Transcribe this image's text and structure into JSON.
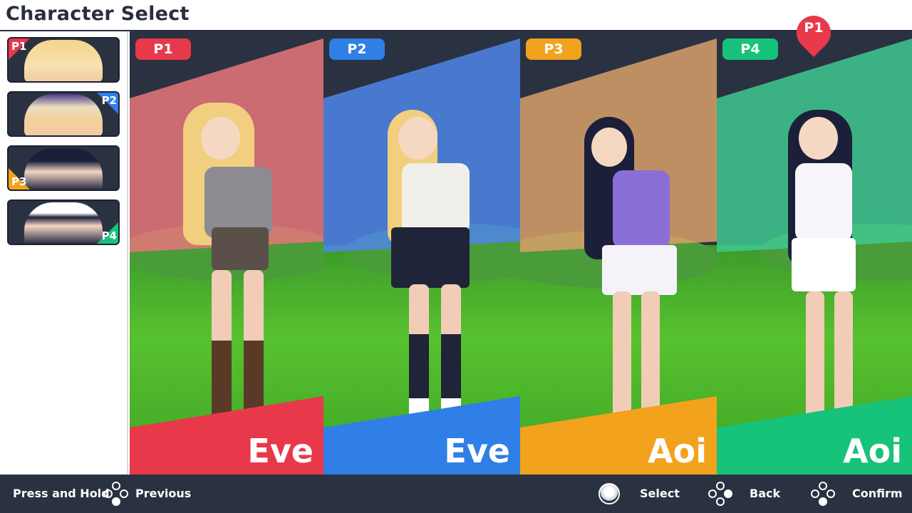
{
  "header": {
    "title": "Character Select"
  },
  "sidebar": {
    "slots": [
      {
        "tag": "P1",
        "color": "#e8394a"
      },
      {
        "tag": "P2",
        "color": "#2f7fe6"
      },
      {
        "tag": "P3",
        "color": "#f2a21c"
      },
      {
        "tag": "P4",
        "color": "#17c27a"
      }
    ]
  },
  "panels": [
    {
      "player": "P1",
      "name": "Eve",
      "color": "#e8394a"
    },
    {
      "player": "P2",
      "name": "Eve",
      "color": "#2f7fe6"
    },
    {
      "player": "P3",
      "name": "Aoi",
      "color": "#f2a21c"
    },
    {
      "player": "P4",
      "name": "Aoi",
      "color": "#17c27a"
    }
  ],
  "cursor": {
    "label": "P1",
    "color": "#e8394a"
  },
  "footer": {
    "press_hold": "Press and Hold",
    "previous": "Previous",
    "select": "Select",
    "back": "Back",
    "confirm": "Confirm"
  }
}
